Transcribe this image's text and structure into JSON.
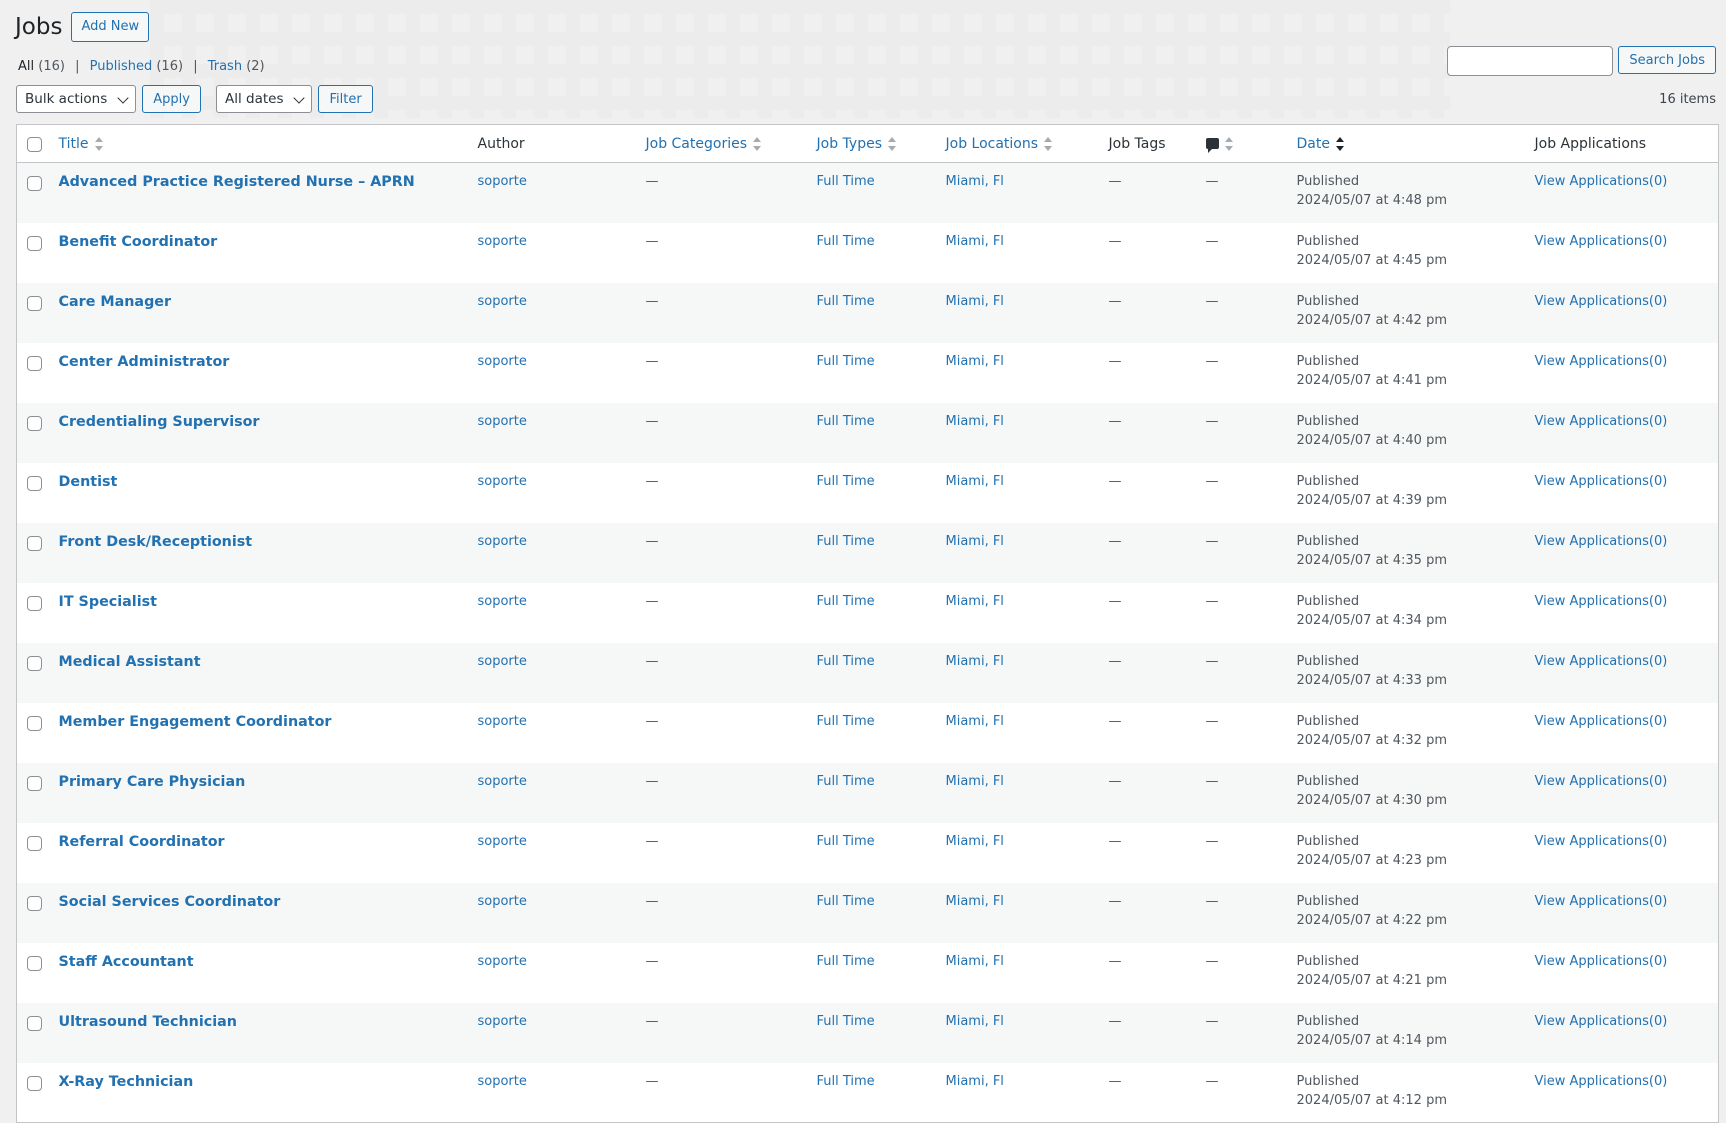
{
  "header": {
    "title": "Jobs",
    "add_new": "Add New"
  },
  "views": {
    "all_label": "All",
    "all_count": "(16)",
    "published_label": "Published",
    "published_count": "(16)",
    "trash_label": "Trash",
    "trash_count": "(2)",
    "separator": "|"
  },
  "search": {
    "button": "Search Jobs",
    "value": ""
  },
  "tablenav": {
    "bulk_actions": "Bulk actions",
    "apply": "Apply",
    "dates": "All dates",
    "filter": "Filter",
    "items_count": "16 items"
  },
  "columns": {
    "title": "Title",
    "author": "Author",
    "categories": "Job Categories",
    "types": "Job Types",
    "locations": "Job Locations",
    "tags": "Job Tags",
    "date": "Date",
    "applications": "Job Applications"
  },
  "rows": [
    {
      "title": "Advanced Practice Registered Nurse – APRN",
      "author": "soporte",
      "categories": "—",
      "type": "Full Time",
      "location": "Miami, Fl",
      "tags": "—",
      "comments": "—",
      "status": "Published",
      "date": "2024/05/07 at 4:48 pm",
      "applications": "View Applications(0)"
    },
    {
      "title": "Benefit Coordinator",
      "author": "soporte",
      "categories": "—",
      "type": "Full Time",
      "location": "Miami, Fl",
      "tags": "—",
      "comments": "—",
      "status": "Published",
      "date": "2024/05/07 at 4:45 pm",
      "applications": "View Applications(0)"
    },
    {
      "title": "Care Manager",
      "author": "soporte",
      "categories": "—",
      "type": "Full Time",
      "location": "Miami, Fl",
      "tags": "—",
      "comments": "—",
      "status": "Published",
      "date": "2024/05/07 at 4:42 pm",
      "applications": "View Applications(0)"
    },
    {
      "title": "Center Administrator",
      "author": "soporte",
      "categories": "—",
      "type": "Full Time",
      "location": "Miami, Fl",
      "tags": "—",
      "comments": "—",
      "status": "Published",
      "date": "2024/05/07 at 4:41 pm",
      "applications": "View Applications(0)"
    },
    {
      "title": "Credentialing Supervisor",
      "author": "soporte",
      "categories": "—",
      "type": "Full Time",
      "location": "Miami, Fl",
      "tags": "—",
      "comments": "—",
      "status": "Published",
      "date": "2024/05/07 at 4:40 pm",
      "applications": "View Applications(0)"
    },
    {
      "title": "Dentist",
      "author": "soporte",
      "categories": "—",
      "type": "Full Time",
      "location": "Miami, Fl",
      "tags": "—",
      "comments": "—",
      "status": "Published",
      "date": "2024/05/07 at 4:39 pm",
      "applications": "View Applications(0)"
    },
    {
      "title": "Front Desk/Receptionist",
      "author": "soporte",
      "categories": "—",
      "type": "Full Time",
      "location": "Miami, Fl",
      "tags": "—",
      "comments": "—",
      "status": "Published",
      "date": "2024/05/07 at 4:35 pm",
      "applications": "View Applications(0)"
    },
    {
      "title": "IT Specialist",
      "author": "soporte",
      "categories": "—",
      "type": "Full Time",
      "location": "Miami, Fl",
      "tags": "—",
      "comments": "—",
      "status": "Published",
      "date": "2024/05/07 at 4:34 pm",
      "applications": "View Applications(0)"
    },
    {
      "title": "Medical Assistant",
      "author": "soporte",
      "categories": "—",
      "type": "Full Time",
      "location": "Miami, Fl",
      "tags": "—",
      "comments": "—",
      "status": "Published",
      "date": "2024/05/07 at 4:33 pm",
      "applications": "View Applications(0)"
    },
    {
      "title": "Member Engagement Coordinator",
      "author": "soporte",
      "categories": "—",
      "type": "Full Time",
      "location": "Miami, Fl",
      "tags": "—",
      "comments": "—",
      "status": "Published",
      "date": "2024/05/07 at 4:32 pm",
      "applications": "View Applications(0)"
    },
    {
      "title": "Primary Care Physician",
      "author": "soporte",
      "categories": "—",
      "type": "Full Time",
      "location": "Miami, Fl",
      "tags": "—",
      "comments": "—",
      "status": "Published",
      "date": "2024/05/07 at 4:30 pm",
      "applications": "View Applications(0)"
    },
    {
      "title": "Referral Coordinator",
      "author": "soporte",
      "categories": "—",
      "type": "Full Time",
      "location": "Miami, Fl",
      "tags": "—",
      "comments": "—",
      "status": "Published",
      "date": "2024/05/07 at 4:23 pm",
      "applications": "View Applications(0)"
    },
    {
      "title": "Social Services Coordinator",
      "author": "soporte",
      "categories": "—",
      "type": "Full Time",
      "location": "Miami, Fl",
      "tags": "—",
      "comments": "—",
      "status": "Published",
      "date": "2024/05/07 at 4:22 pm",
      "applications": "View Applications(0)"
    },
    {
      "title": "Staff Accountant",
      "author": "soporte",
      "categories": "—",
      "type": "Full Time",
      "location": "Miami, Fl",
      "tags": "—",
      "comments": "—",
      "status": "Published",
      "date": "2024/05/07 at 4:21 pm",
      "applications": "View Applications(0)"
    },
    {
      "title": "Ultrasound Technician",
      "author": "soporte",
      "categories": "—",
      "type": "Full Time",
      "location": "Miami, Fl",
      "tags": "—",
      "comments": "—",
      "status": "Published",
      "date": "2024/05/07 at 4:14 pm",
      "applications": "View Applications(0)"
    },
    {
      "title": "X-Ray Technician",
      "author": "soporte",
      "categories": "—",
      "type": "Full Time",
      "location": "Miami, Fl",
      "tags": "—",
      "comments": "—",
      "status": "Published",
      "date": "2024/05/07 at 4:12 pm",
      "applications": "View Applications(0)"
    }
  ],
  "colors": {
    "link": "#2271b1",
    "border": "#c3c4c7",
    "bg": "#f0f0f1",
    "stripe": "#f6f7f7"
  },
  "icons": {
    "comment": "comment-bubble-icon",
    "sort": "sort-arrows-icon",
    "dropdown": "chevron-down-icon"
  }
}
